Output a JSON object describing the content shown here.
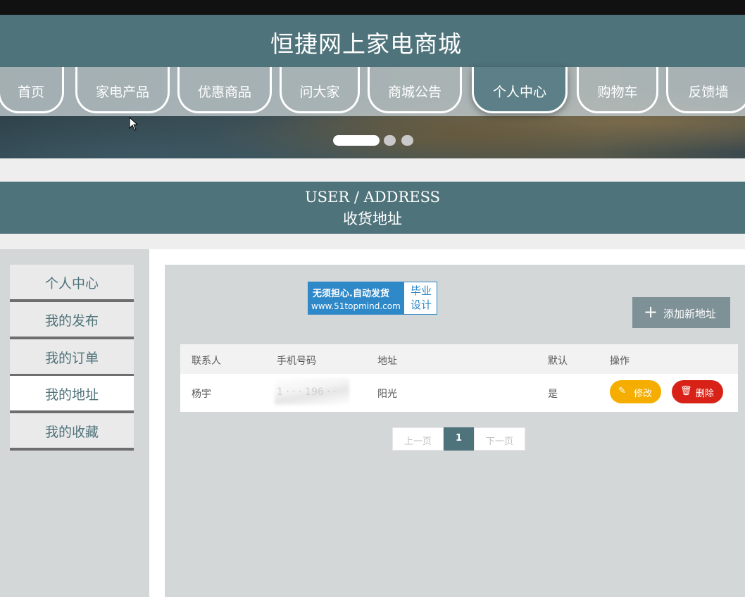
{
  "header": {
    "site_title": "恒捷网上家电商城"
  },
  "nav": {
    "items": [
      {
        "label": "首页"
      },
      {
        "label": "家电产品"
      },
      {
        "label": "优惠商品"
      },
      {
        "label": "问大家"
      },
      {
        "label": "商城公告"
      },
      {
        "label": "个人中心",
        "active": true
      },
      {
        "label": "购物车"
      },
      {
        "label": "反馈墙"
      }
    ]
  },
  "section": {
    "title_en": "USER / ADDRESS",
    "title_cn": "收货地址"
  },
  "sidebar": {
    "items": [
      {
        "label": "个人中心"
      },
      {
        "label": "我的发布"
      },
      {
        "label": "我的订单"
      },
      {
        "label": "我的地址",
        "active": true
      },
      {
        "label": "我的收藏"
      }
    ]
  },
  "ad": {
    "line1": "无须担心.自动发货",
    "line2": "www.51topmind.com",
    "right_line1": "毕业",
    "right_line2": "设计"
  },
  "toolbar": {
    "add_label": "添加新地址",
    "add_icon": "plus-icon"
  },
  "table": {
    "columns": [
      "联系人",
      "手机号码",
      "地址",
      "默认",
      "操作"
    ],
    "rows": [
      {
        "contact": "杨宇",
        "phone": "1 · · · 196 · ·",
        "address": "阳光",
        "default": "是",
        "edit_label": "修改",
        "delete_label": "删除"
      }
    ]
  },
  "pager": {
    "prev_label": "上一页",
    "current_page": "1",
    "next_label": "下一页"
  },
  "colors": {
    "brand": "#4f737b",
    "edit": "#f5ad00",
    "delete": "#d82217",
    "ad_blue": "#2f88c8"
  }
}
